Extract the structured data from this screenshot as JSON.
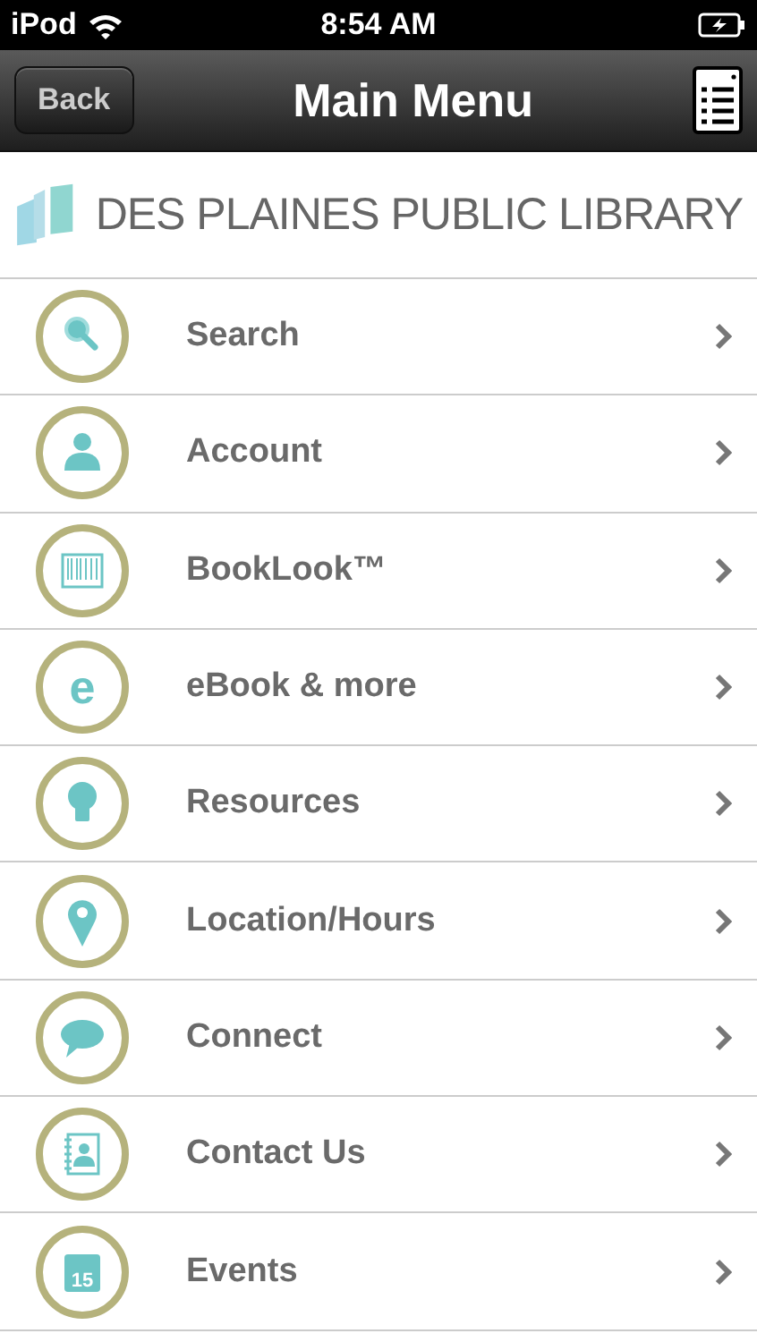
{
  "status_bar": {
    "carrier": "iPod",
    "time": "8:54 AM"
  },
  "nav_bar": {
    "back": "Back",
    "title": "Main Menu"
  },
  "logo": {
    "text": "DES PLAINES PUBLIC LIBRARY"
  },
  "menu": [
    {
      "kind": "search",
      "label": "Search"
    },
    {
      "kind": "account",
      "label": "Account"
    },
    {
      "kind": "barcode",
      "label": "BookLook™"
    },
    {
      "kind": "ebook",
      "label": "eBook & more",
      "icon_text": "e"
    },
    {
      "kind": "bulb",
      "label": "Resources"
    },
    {
      "kind": "pin",
      "label": "Location/Hours"
    },
    {
      "kind": "chat",
      "label": "Connect"
    },
    {
      "kind": "contact",
      "label": "Contact Us"
    },
    {
      "kind": "calendar",
      "label": "Events",
      "icon_text": "15"
    }
  ]
}
